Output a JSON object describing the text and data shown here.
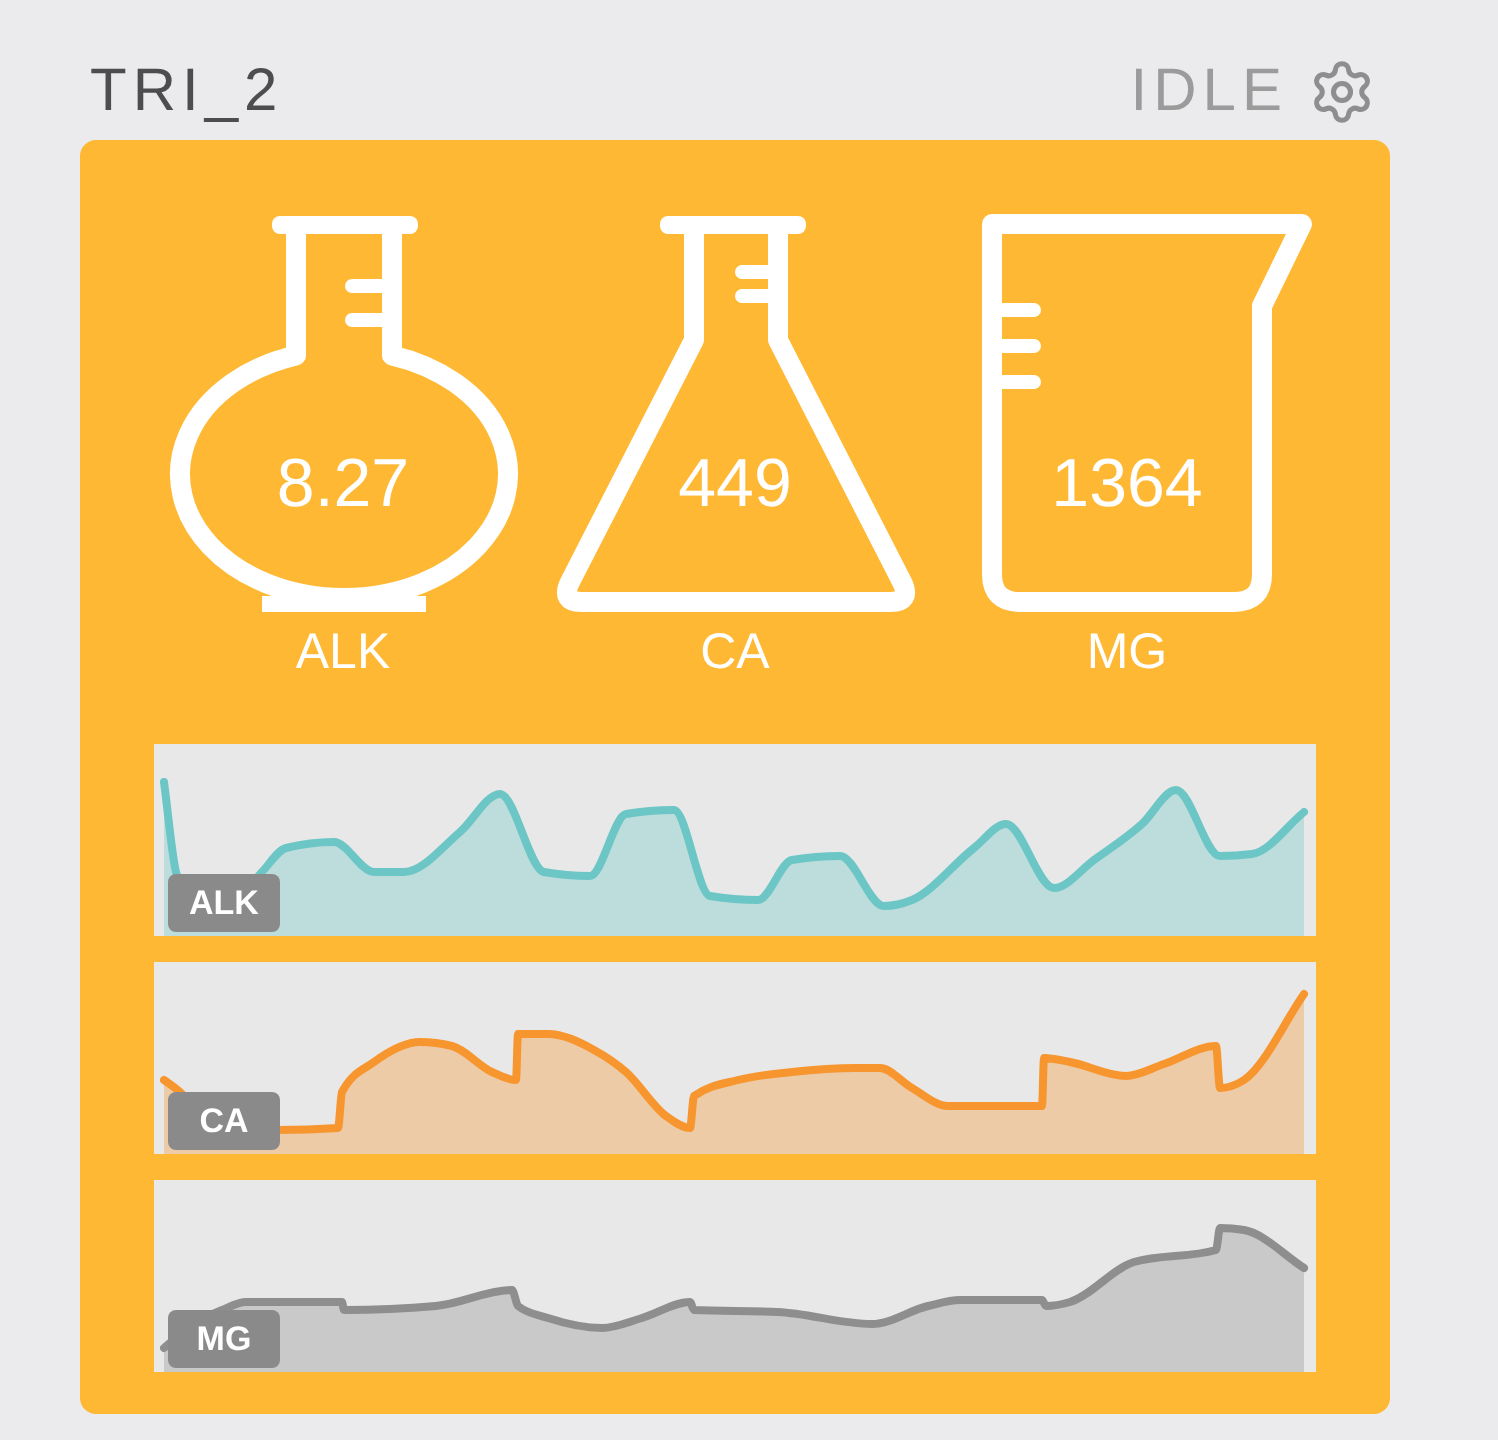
{
  "header": {
    "title": "TRI_2",
    "status": "IDLE"
  },
  "vessels": [
    {
      "kind": "round-flask",
      "value": "8.27",
      "label": "ALK"
    },
    {
      "kind": "conical-flask",
      "value": "449",
      "label": "CA"
    },
    {
      "kind": "beaker",
      "value": "1364",
      "label": "MG"
    }
  ],
  "charts": [
    {
      "label": "ALK",
      "color": "#6cc6c6"
    },
    {
      "label": "CA",
      "color": "#f7962f"
    },
    {
      "label": "MG",
      "color": "#8e8e8e"
    }
  ]
}
